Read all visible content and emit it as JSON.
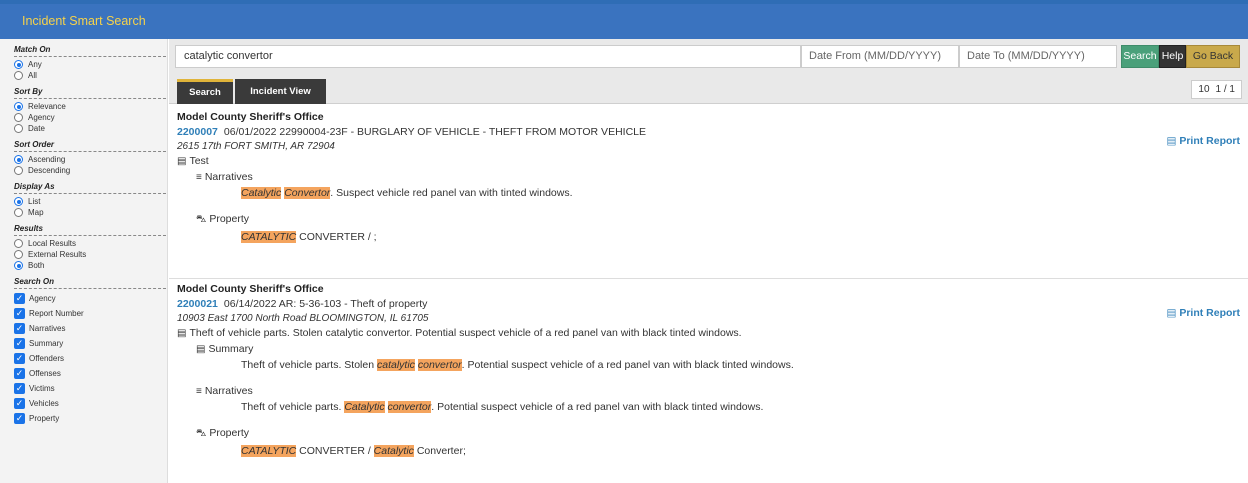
{
  "app": {
    "title": "Incident Smart Search"
  },
  "sidebar": {
    "match_on": {
      "title": "Match On",
      "options": [
        "Any",
        "All"
      ]
    },
    "sort_by": {
      "title": "Sort By",
      "options": [
        "Relevance",
        "Agency",
        "Date"
      ]
    },
    "sort_order": {
      "title": "Sort Order",
      "options": [
        "Ascending",
        "Descending"
      ]
    },
    "display_as": {
      "title": "Display As",
      "options": [
        "List",
        "Map"
      ]
    },
    "results": {
      "title": "Results",
      "options": [
        "Local Results",
        "External Results",
        "Both"
      ]
    },
    "search_on": {
      "title": "Search On",
      "options": [
        "Agency",
        "Report Number",
        "Narratives",
        "Summary",
        "Offenders",
        "Offenses",
        "Victims",
        "Vehicles",
        "Property"
      ]
    }
  },
  "search": {
    "query": "catalytic convertor",
    "date_from_placeholder": "Date From (MM/DD/YYYY)",
    "date_to_placeholder": "Date To (MM/DD/YYYY)",
    "search_label": "Search",
    "help_label": "Help",
    "back_label": "Go Back"
  },
  "tabs": {
    "search": "Search",
    "incident_view": "Incident View"
  },
  "pager": {
    "per_page": "10",
    "page": "1 / 1"
  },
  "results": [
    {
      "agency": "Model County Sheriff's Office",
      "number": "2200007",
      "details": "06/01/2022  22990004-23F - BURGLARY OF VEHICLE - THEFT FROM MOTOR VEHICLE",
      "address": "2615 17th FORT SMITH, AR 72904",
      "description": "Test",
      "print_label": "Print Report",
      "narratives_label": "Narratives",
      "narratives_hl1": "Catalytic",
      "narratives_hl2": "Convertor",
      "narratives_rest": ". Suspect vehicle red panel van with tinted windows.",
      "property_label": "Property",
      "property_hl": "CATALYTIC",
      "property_rest": " CONVERTER / ;"
    },
    {
      "agency": "Model County Sheriff's Office",
      "number": "2200021",
      "details": "06/14/2022  AR: 5-36-103 - Theft of property",
      "address": "10903 East 1700 North Road BLOOMINGTON, IL 61705",
      "description": "Theft of vehicle parts. Stolen catalytic convertor. Potential suspect vehicle of a red panel van with black tinted windows.",
      "print_label": "Print Report",
      "summary_label": "Summary",
      "summary_pre": "Theft of vehicle parts. Stolen ",
      "summary_hl1": "catalytic",
      "summary_hl2": "convertor",
      "summary_rest": ". Potential suspect vehicle of a red panel van with black tinted windows.",
      "narratives_label": "Narratives",
      "narratives_pre": "Theft of vehicle parts. ",
      "narratives_hl1": "Catalytic",
      "narratives_hl2": "convertor",
      "narratives_rest": ". Potential suspect vehicle of a red panel van with black tinted windows.",
      "property_label": "Property",
      "property_hl1": "CATALYTIC",
      "property_mid": " CONVERTER / ",
      "property_hl2": "Catalytic",
      "property_rest": " Converter;"
    }
  ],
  "colors": {
    "header": "#3a73bf",
    "title": "#f6d24a",
    "highlight": "#f4a45e",
    "link": "#2f7fb8"
  }
}
